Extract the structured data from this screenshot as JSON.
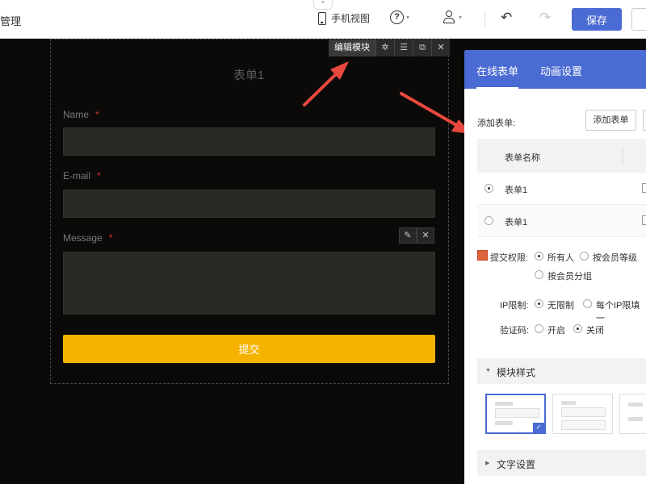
{
  "topbar": {
    "manage_label": "管理",
    "mobile_view_label": "手机视图",
    "help_icon_text": "?",
    "undo_glyph": "↶",
    "redo_glyph": "↷",
    "save_label": "保存"
  },
  "module": {
    "toolbar": {
      "edit_label": "编辑模块"
    },
    "title": "表单1",
    "fields": [
      {
        "label": "Name",
        "required_mark": "*"
      },
      {
        "label": "E-mail",
        "required_mark": "*"
      },
      {
        "label": "Message",
        "required_mark": "*"
      }
    ],
    "submit_label": "提交"
  },
  "panel": {
    "tabs": [
      {
        "label": "在线表单",
        "active": true
      },
      {
        "label": "动画设置",
        "active": false
      }
    ],
    "add_form_label": "添加表单:",
    "add_form_button": "添加表单",
    "table": {
      "header_name": "表单名称",
      "rows": [
        {
          "name": "表单1",
          "selected": true
        },
        {
          "name": "表单1",
          "selected": false
        }
      ]
    },
    "submit_permission": {
      "label": "提交权限:",
      "options": [
        "所有人",
        "按会员等级",
        "按会员分组"
      ],
      "selected": "所有人"
    },
    "ip_limit": {
      "label": "IP限制:",
      "options": [
        "无限制",
        "每个IP限填一"
      ],
      "selected": "无限制"
    },
    "captcha": {
      "label": "验证码:",
      "options": [
        "开启",
        "关闭"
      ],
      "selected": "关闭"
    },
    "module_style_label": "模块样式",
    "text_settings_label": "文字设置"
  },
  "colors": {
    "accent": "#4a6bd3",
    "submit_button": "#f5b300",
    "canvas_background": "#0c0a08",
    "annotation_arrow": "#e8493f"
  }
}
